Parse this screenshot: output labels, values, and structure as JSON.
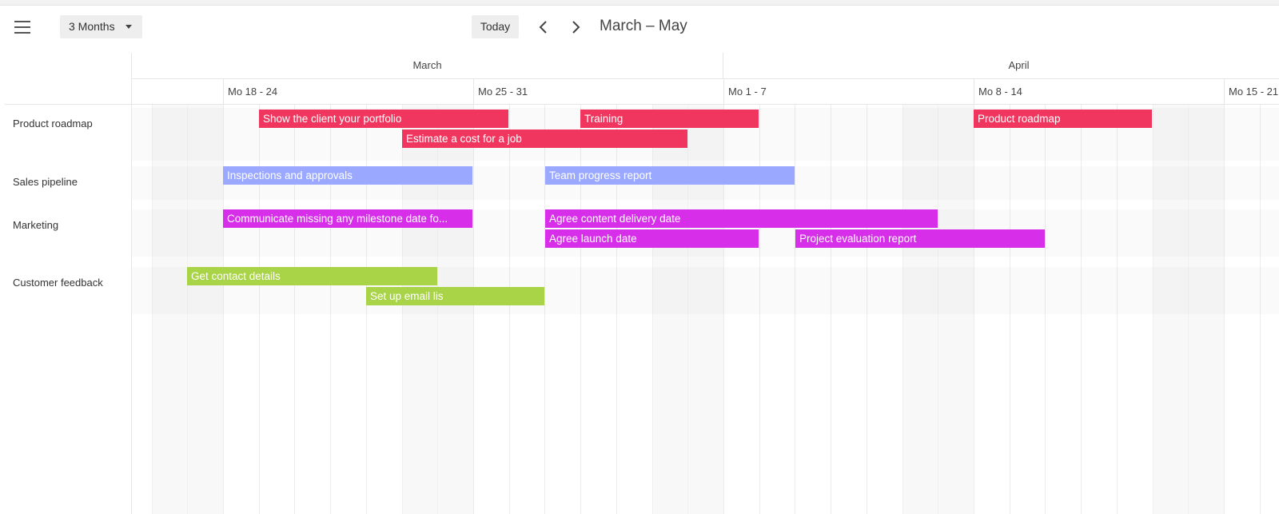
{
  "toolbar": {
    "menu_icon": "hamburger-menu-icon",
    "view_label": "3 Months",
    "today_label": "Today",
    "prev_icon": "chevron-left-icon",
    "next_icon": "chevron-right-icon",
    "period_title": "March – May"
  },
  "colors": {
    "product": "#f0365e",
    "sales": "#9aa8ff",
    "marketing": "#d62ee9",
    "feedback": "#a9d448"
  },
  "months": [
    "March",
    "April"
  ],
  "weeks": [
    "Mo 18 - 24",
    "Mo 25 - 31",
    "Mo 1 - 7",
    "Mo 8 - 14",
    "Mo 15 - 21"
  ],
  "resources": [
    {
      "name": "Product roadmap"
    },
    {
      "name": "Sales pipeline"
    },
    {
      "name": "Marketing"
    },
    {
      "name": "Customer feedback"
    }
  ],
  "events": [
    {
      "title": "Show the client your portfolio",
      "resource": "Product roadmap",
      "color": "product"
    },
    {
      "title": "Training",
      "resource": "Product roadmap",
      "color": "product"
    },
    {
      "title": "Product roadmap",
      "resource": "Product roadmap",
      "color": "product"
    },
    {
      "title": "Estimate a cost for a job",
      "resource": "Product roadmap",
      "color": "product"
    },
    {
      "title": "Inspections and approvals",
      "resource": "Sales pipeline",
      "color": "sales"
    },
    {
      "title": "Team progress report",
      "resource": "Sales pipeline",
      "color": "sales"
    },
    {
      "title": "Communicate missing any milestone date fo...",
      "resource": "Marketing",
      "color": "marketing"
    },
    {
      "title": "Agree content delivery date",
      "resource": "Marketing",
      "color": "marketing"
    },
    {
      "title": "Agree launch date",
      "resource": "Marketing",
      "color": "marketing"
    },
    {
      "title": "Project evaluation report",
      "resource": "Marketing",
      "color": "marketing"
    },
    {
      "title": "Get contact details",
      "resource": "Customer feedback",
      "color": "feedback"
    },
    {
      "title": "Set up email lis",
      "resource": "Customer feedback",
      "color": "feedback"
    }
  ]
}
